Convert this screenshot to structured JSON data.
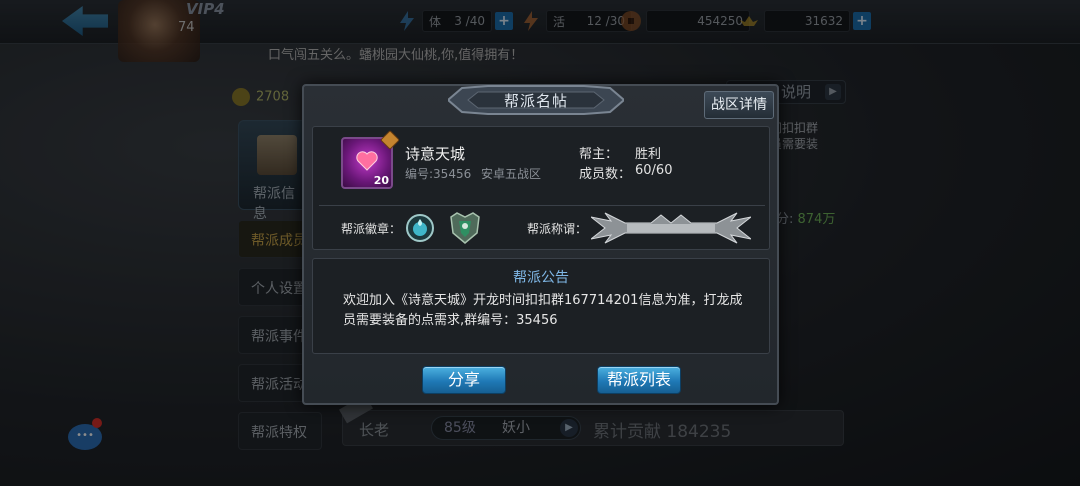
{
  "header": {
    "vip": "VIP4",
    "level": "74",
    "stamina_label": "体",
    "stamina": "3 /40",
    "vigor_label": "活",
    "vigor": "12 /30",
    "copper": "454250",
    "gold": "31632"
  },
  "marquee": "口气闯五关么。蟠桃园大仙桃,你,值得拥有！",
  "background": {
    "coins": "2708",
    "explain_label": "说明",
    "nav": [
      {
        "label": "帮派信息"
      },
      {
        "label": "帮派成员"
      },
      {
        "label": "个人设置"
      },
      {
        "label": "帮派事件"
      },
      {
        "label": "帮派活动"
      },
      {
        "label": "帮派特权"
      }
    ],
    "right_text": "间扣扣群\n员需要装",
    "score_label": "分:",
    "score_value": "874万",
    "member": {
      "role": "长老",
      "level": "85级",
      "name": "妖小",
      "contrib": "累计贡献 184235"
    }
  },
  "modal": {
    "title": "帮派名帖",
    "region_button": "战区详情",
    "guild": {
      "name": "诗意天城",
      "level": "20",
      "id_text": "编号:35456",
      "server": "安卓五战区",
      "leader_label": "帮主：",
      "leader": "胜利",
      "members_label": "成员数：",
      "members": "60/60"
    },
    "emblem_label": "帮派徽章：",
    "title_label": "帮派称谓：",
    "notice": {
      "heading": "帮派公告",
      "body": "欢迎加入《诗意天城》开龙时间扣扣群167714201信息为准，打龙成员需要装备的点需求,群编号：35456"
    },
    "share_button": "分享",
    "list_button": "帮派列表"
  },
  "colors": {
    "accent_blue": "#1f79b6",
    "notice_heading": "#7fb7e6",
    "guild_icon": "#c03ac8"
  },
  "icons": [
    "back-arrow-icon",
    "stamina-icon",
    "vigor-icon",
    "copper-coin-icon",
    "gold-ingot-icon",
    "heart-icon",
    "emblem-orb-icon",
    "emblem-shield-icon",
    "chat-icon"
  ]
}
